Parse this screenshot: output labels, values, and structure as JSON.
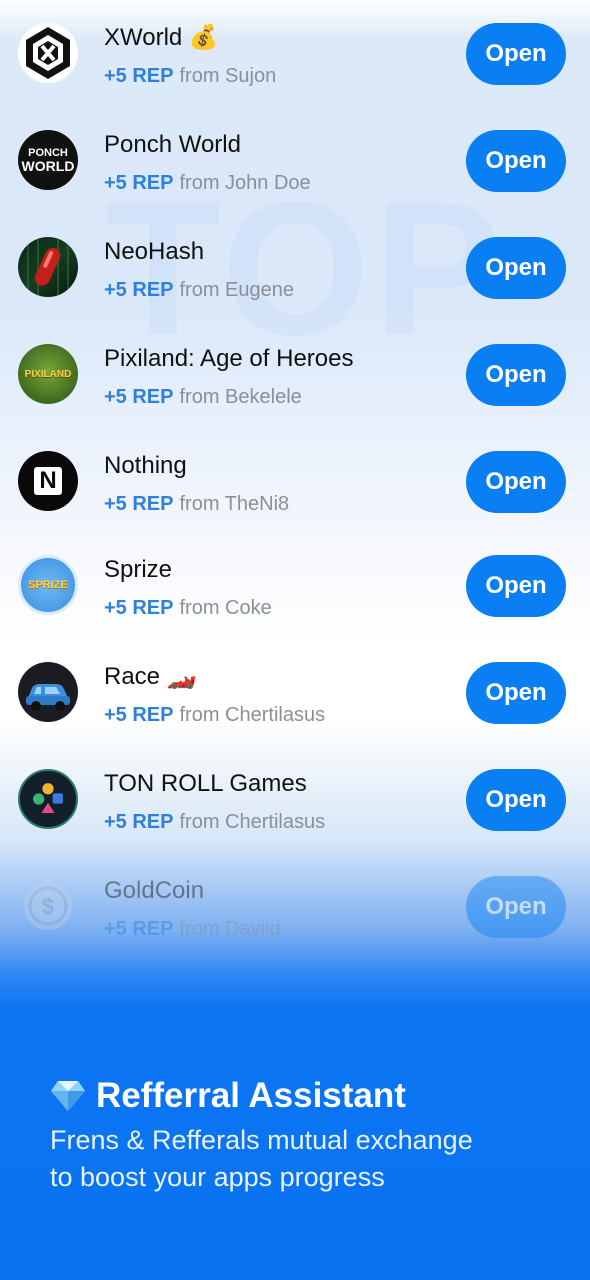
{
  "watermark": "TOP",
  "apps": [
    {
      "name": "XWorld",
      "emoji": "💰",
      "rep": "+5 REP",
      "from": "from Sujon",
      "button": "Open",
      "icon": "xworld-logo-icon"
    },
    {
      "name": "Ponch World",
      "emoji": "",
      "rep": "+5 REP",
      "from": "from John Doe",
      "button": "Open",
      "icon": "ponch-world-logo-icon",
      "logo_text": [
        "PONCH",
        "WORLD"
      ]
    },
    {
      "name": "NeoHash",
      "emoji": "",
      "rep": "+5 REP",
      "from": "from Eugene",
      "button": "Open",
      "icon": "red-pill-icon"
    },
    {
      "name": "Pixiland: Age of Heroes",
      "emoji": "",
      "rep": "+5 REP",
      "from": "from Bekelele",
      "button": "Open",
      "icon": "pixiland-logo-icon",
      "logo_text": [
        "PIXILAND"
      ]
    },
    {
      "name": "Nothing",
      "emoji": "",
      "rep": "+5 REP",
      "from": "from TheNi8",
      "button": "Open",
      "icon": "nothing-n-logo-icon",
      "logo_text": [
        "N"
      ]
    },
    {
      "name": "Sprize",
      "emoji": "",
      "rep": "+5 REP",
      "from": "from Coke",
      "button": "Open",
      "icon": "sprize-logo-icon",
      "logo_text": [
        "SPRIZE"
      ]
    },
    {
      "name": "Race",
      "emoji": "🏎️",
      "rep": "+5 REP",
      "from": "from Chertilasus",
      "button": "Open",
      "icon": "blue-car-icon"
    },
    {
      "name": "TON ROLL Games",
      "emoji": "",
      "rep": "+5 REP",
      "from": "from Chertilasus",
      "button": "Open",
      "icon": "gamepad-shapes-icon"
    },
    {
      "name": "GoldCoin",
      "emoji": "",
      "rep": "+5 REP",
      "from": "from Daviid",
      "button": "Open",
      "icon": "gold-coin-icon"
    }
  ],
  "footer": {
    "title": "Refferral Assistant",
    "subtitle_line1": "Frens & Refferals mutual exchange",
    "subtitle_line2": "to boost your apps progress",
    "icon": "diamond-icon"
  },
  "colors": {
    "accent": "#0a7ff4",
    "rep": "#2f7fdc",
    "footer_bg": "#0a73f2"
  }
}
